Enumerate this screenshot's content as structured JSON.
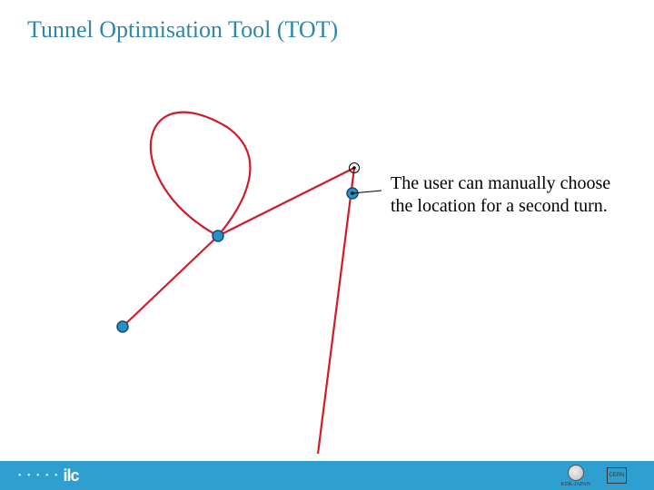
{
  "title": "Tunnel Optimisation Tool (TOT)",
  "caption": "The user can manually choose the location for a second turn.",
  "footer": {
    "dots": "• • • • •",
    "ilc": "ilc",
    "kek_label": "KEK-JAPAN",
    "cern_label": "CERN"
  },
  "diagram": {
    "description": "Red tunnel trajectory with a large loop in the upper-left, two long straight segments diverging downward, three blue control points and two small black endpoint markers.",
    "colors": {
      "path": "#d11b2a",
      "point_fill": "#2a8fc7",
      "point_stroke": "#0d4f7a",
      "marker": "#000"
    }
  }
}
